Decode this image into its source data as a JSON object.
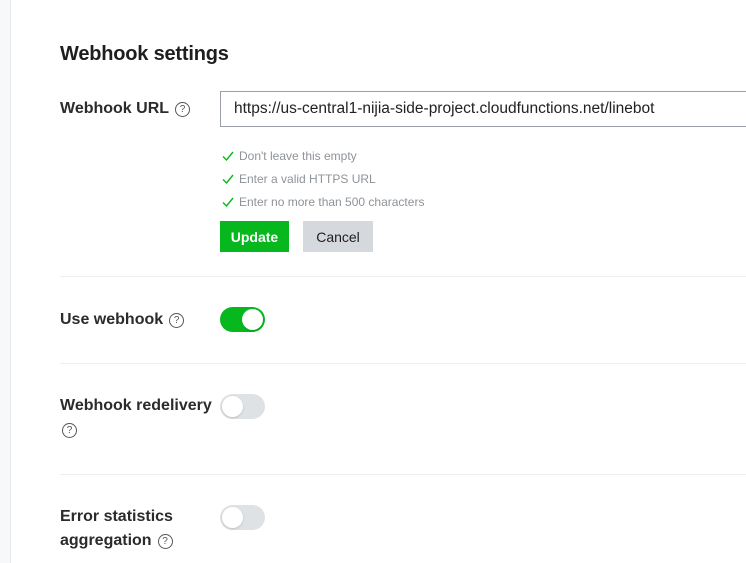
{
  "section": {
    "title": "Webhook settings"
  },
  "webhook_url": {
    "label": "Webhook URL",
    "value": "https://us-central1-nijia-side-project.cloudfunctions.net/linebot",
    "rules": [
      "Don't leave this empty",
      "Enter a valid HTTPS URL",
      "Enter no more than 500 characters"
    ],
    "update_label": "Update",
    "cancel_label": "Cancel"
  },
  "use_webhook": {
    "label": "Use webhook",
    "enabled": true
  },
  "redelivery": {
    "label": "Webhook redelivery",
    "enabled": false
  },
  "error_stats": {
    "label_line1": "Error statistics",
    "label_line2": "aggregation",
    "enabled": false
  },
  "help_glyph": "?",
  "colors": {
    "accent": "#06b81e",
    "toggle_off": "#dfe2e5",
    "cancel_bg": "#d5d8dc",
    "rule_text": "#8e9399"
  }
}
